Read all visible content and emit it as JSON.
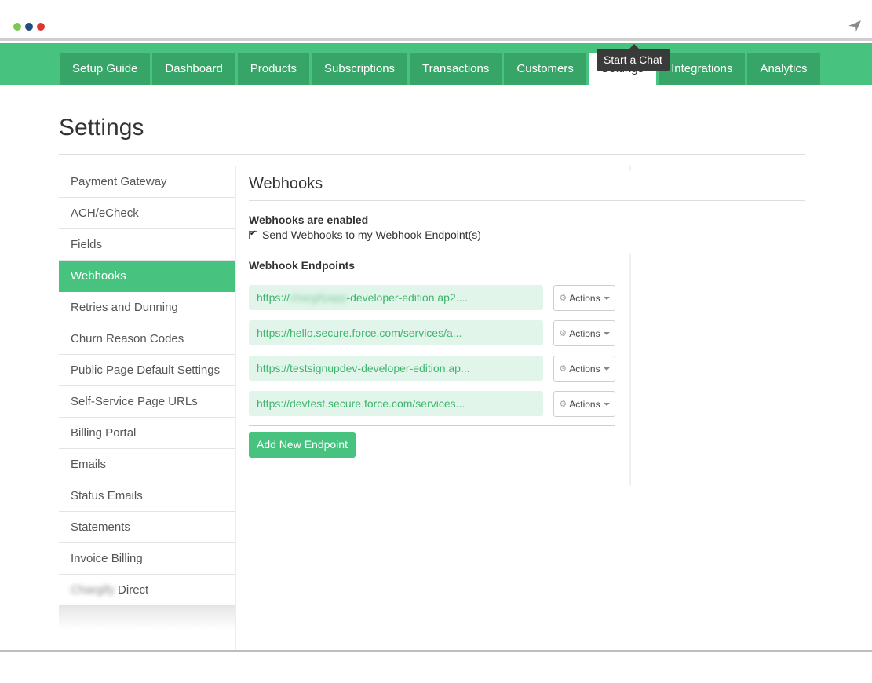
{
  "window": {
    "controls": [
      "green-dot",
      "blue-dot",
      "red-dot"
    ],
    "nav_icon": "location-arrow-icon"
  },
  "nav": {
    "tabs": [
      {
        "label": "Setup Guide",
        "active": false
      },
      {
        "label": "Dashboard",
        "active": false
      },
      {
        "label": "Products",
        "active": false
      },
      {
        "label": "Subscriptions",
        "active": false
      },
      {
        "label": "Transactions",
        "active": false
      },
      {
        "label": "Customers",
        "active": false
      },
      {
        "label": "Settings",
        "active": true
      },
      {
        "label": "Integrations",
        "active": false
      },
      {
        "label": "Analytics",
        "active": false
      }
    ],
    "tooltip": "Start a Chat"
  },
  "page": {
    "title": "Settings"
  },
  "sidebar": {
    "items": [
      {
        "label": "Payment Gateway"
      },
      {
        "label": "ACH/eCheck"
      },
      {
        "label": "Fields"
      },
      {
        "label": "Webhooks",
        "active": true
      },
      {
        "label": "Retries and Dunning"
      },
      {
        "label": "Churn Reason Codes"
      },
      {
        "label": "Public Page Default Settings"
      },
      {
        "label": "Self-Service Page URLs"
      },
      {
        "label": "Billing Portal"
      },
      {
        "label": "Emails"
      },
      {
        "label": "Status Emails"
      },
      {
        "label": "Statements"
      },
      {
        "label": "Invoice Billing"
      },
      {
        "label": "Direct",
        "blurred_prefix": "Chargify"
      }
    ]
  },
  "webhooks": {
    "title": "Webhooks",
    "status": "Webhooks are enabled",
    "checkbox_label": "Send Webhooks to my Webhook Endpoint(s)",
    "checkbox_checked": true,
    "endpoints_label": "Webhook Endpoints",
    "endpoints": [
      {
        "prefix": "https://",
        "blurred": "chargifyapp",
        "suffix": "-developer-edition.ap2...."
      },
      {
        "prefix": "https://hello.secure.force.com/services/a...",
        "blurred": "",
        "suffix": ""
      },
      {
        "prefix": "https://testsignupdev-developer-edition.ap...",
        "blurred": "",
        "suffix": ""
      },
      {
        "prefix": "https://devtest.secure.force.com/services...",
        "blurred": "",
        "suffix": ""
      }
    ],
    "actions_label": "Actions",
    "add_button": "Add New Endpoint"
  },
  "colors": {
    "brand_green": "#48c37f",
    "tab_green": "#37a567",
    "endpoint_bg": "#e1f5ea",
    "endpoint_text": "#3fb56e"
  }
}
